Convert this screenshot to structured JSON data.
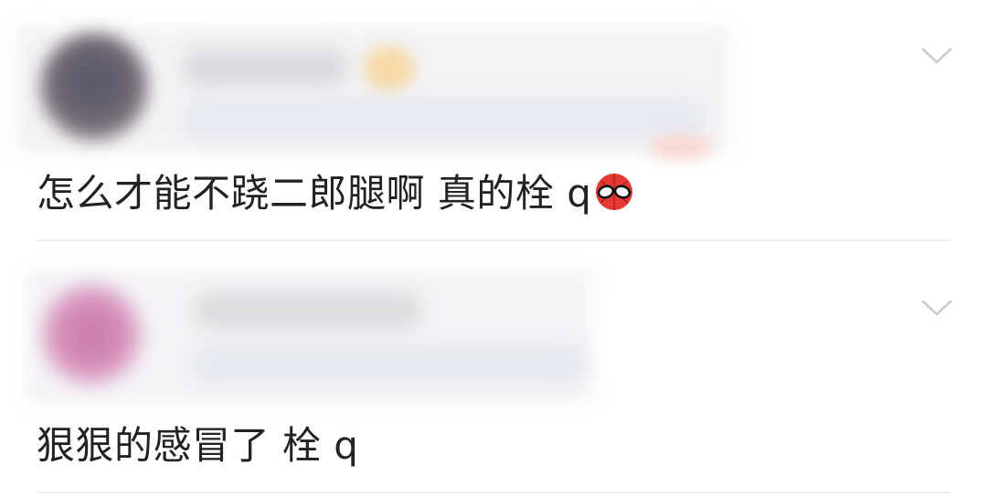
{
  "comments": [
    {
      "text": "怎么才能不跷二郎腿啊 真的栓 q",
      "trailing_emoji": "spider-man-face-emoji",
      "author_redacted": true,
      "menu_icon": "chevron-down-icon"
    },
    {
      "text": "狠狠的感冒了 栓 q",
      "author_redacted": true,
      "menu_icon": "chevron-down-icon"
    }
  ],
  "colors": {
    "background": "#ffffff",
    "text": "#222222",
    "divider": "#eeeeee",
    "chevron": "#c8c8c8",
    "emoji_red": "#e53935"
  }
}
